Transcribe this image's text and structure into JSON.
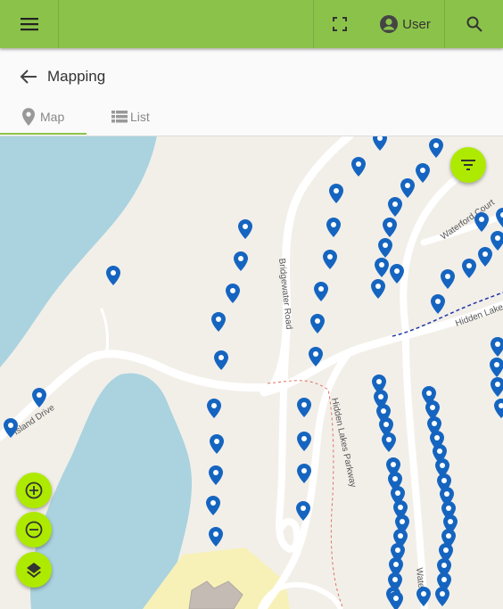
{
  "header": {
    "menu_icon": "hamburger-menu-icon",
    "fullscreen_icon": "fullscreen-icon",
    "account_icon": "account-circle-icon",
    "user_label": "User",
    "search_icon": "search-icon",
    "bar_color": "#8bc34a"
  },
  "page": {
    "back_icon": "arrow-back-icon",
    "title": "Mapping"
  },
  "tabs": [
    {
      "label": "Map",
      "icon": "map-marker-icon",
      "active": true
    },
    {
      "label": "List",
      "icon": "list-icon",
      "active": false
    }
  ],
  "map": {
    "road_labels": [
      "Island Drive",
      "Bridgewater Road",
      "Hidden Lakes Parkway",
      "Waterford Court",
      "Hidden Lake",
      "Waterfor"
    ],
    "marker_color": "#1565c0",
    "controls": {
      "filter_icon": "filter-icon",
      "zoom_in_icon": "zoom-in-icon",
      "zoom_out_icon": "zoom-out-icon",
      "layers_icon": "layers-icon",
      "accent": "#aeea00"
    }
  }
}
